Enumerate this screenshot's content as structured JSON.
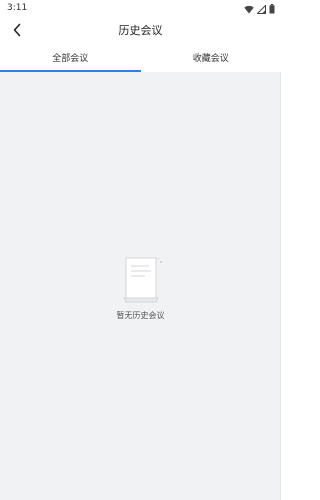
{
  "status_bar": {
    "time": "3:11",
    "icons": [
      "wifi-icon",
      "signal-icon",
      "battery-icon"
    ]
  },
  "header": {
    "title": "历史会议",
    "back_icon": "back-arrow-icon"
  },
  "tabs": [
    {
      "label": "全部会议",
      "active": true
    },
    {
      "label": "收藏会议",
      "active": false
    }
  ],
  "empty_state": {
    "icon": "document-icon",
    "message": "暂无历史会议"
  },
  "colors": {
    "accent": "#2f7ee6",
    "content_bg": "#f1f2f4"
  }
}
